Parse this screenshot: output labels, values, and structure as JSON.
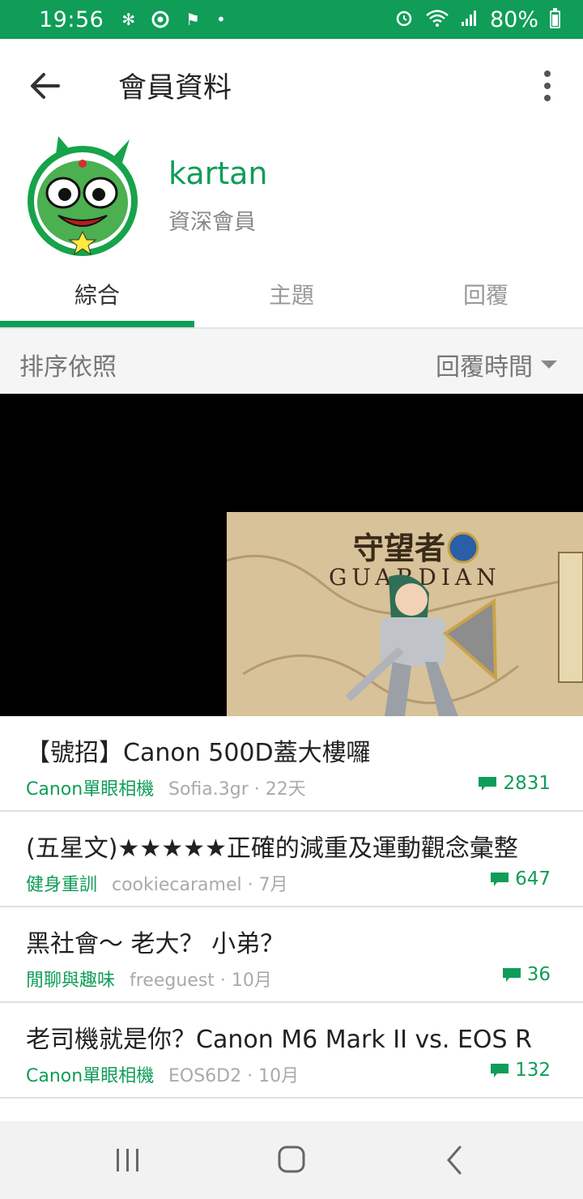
{
  "status_bar": {
    "time": "19:56",
    "battery": "80%",
    "battery_level": 0.8
  },
  "app_bar": {
    "title": "會員資料"
  },
  "profile": {
    "username": "kartan",
    "rank": "資深會員"
  },
  "tabs": [
    {
      "label": "綜合",
      "active": true
    },
    {
      "label": "主題",
      "active": false
    },
    {
      "label": "回覆",
      "active": false
    }
  ],
  "sort": {
    "label": "排序依照",
    "value": "回覆時間"
  },
  "banner": {
    "title_cn": "守望者",
    "title_en": "GUARDIAN"
  },
  "posts": [
    {
      "title": "【號招】Canon 500D蓋大樓囉",
      "board": "Canon單眼相機",
      "meta": "Sofia.3gr · 22天",
      "replies": "2831"
    },
    {
      "title": "(五星文)★★★★★正確的減重及運動觀念彙整",
      "board": "健身重訓",
      "meta": "cookiecaramel · 7月",
      "replies": "647"
    },
    {
      "title": "黑社會～ 老大？ 小弟？",
      "board": "閒聊與趣味",
      "meta": "freeguest · 10月",
      "replies": "36"
    },
    {
      "title": "老司機就是你？Canon M6 Mark II vs. EOS R",
      "board": "Canon單眼相機",
      "meta": "EOS6D2 · 10月",
      "replies": "132"
    }
  ],
  "colors": {
    "accent": "#0f9d58",
    "text": "#222222",
    "muted": "#999999"
  }
}
